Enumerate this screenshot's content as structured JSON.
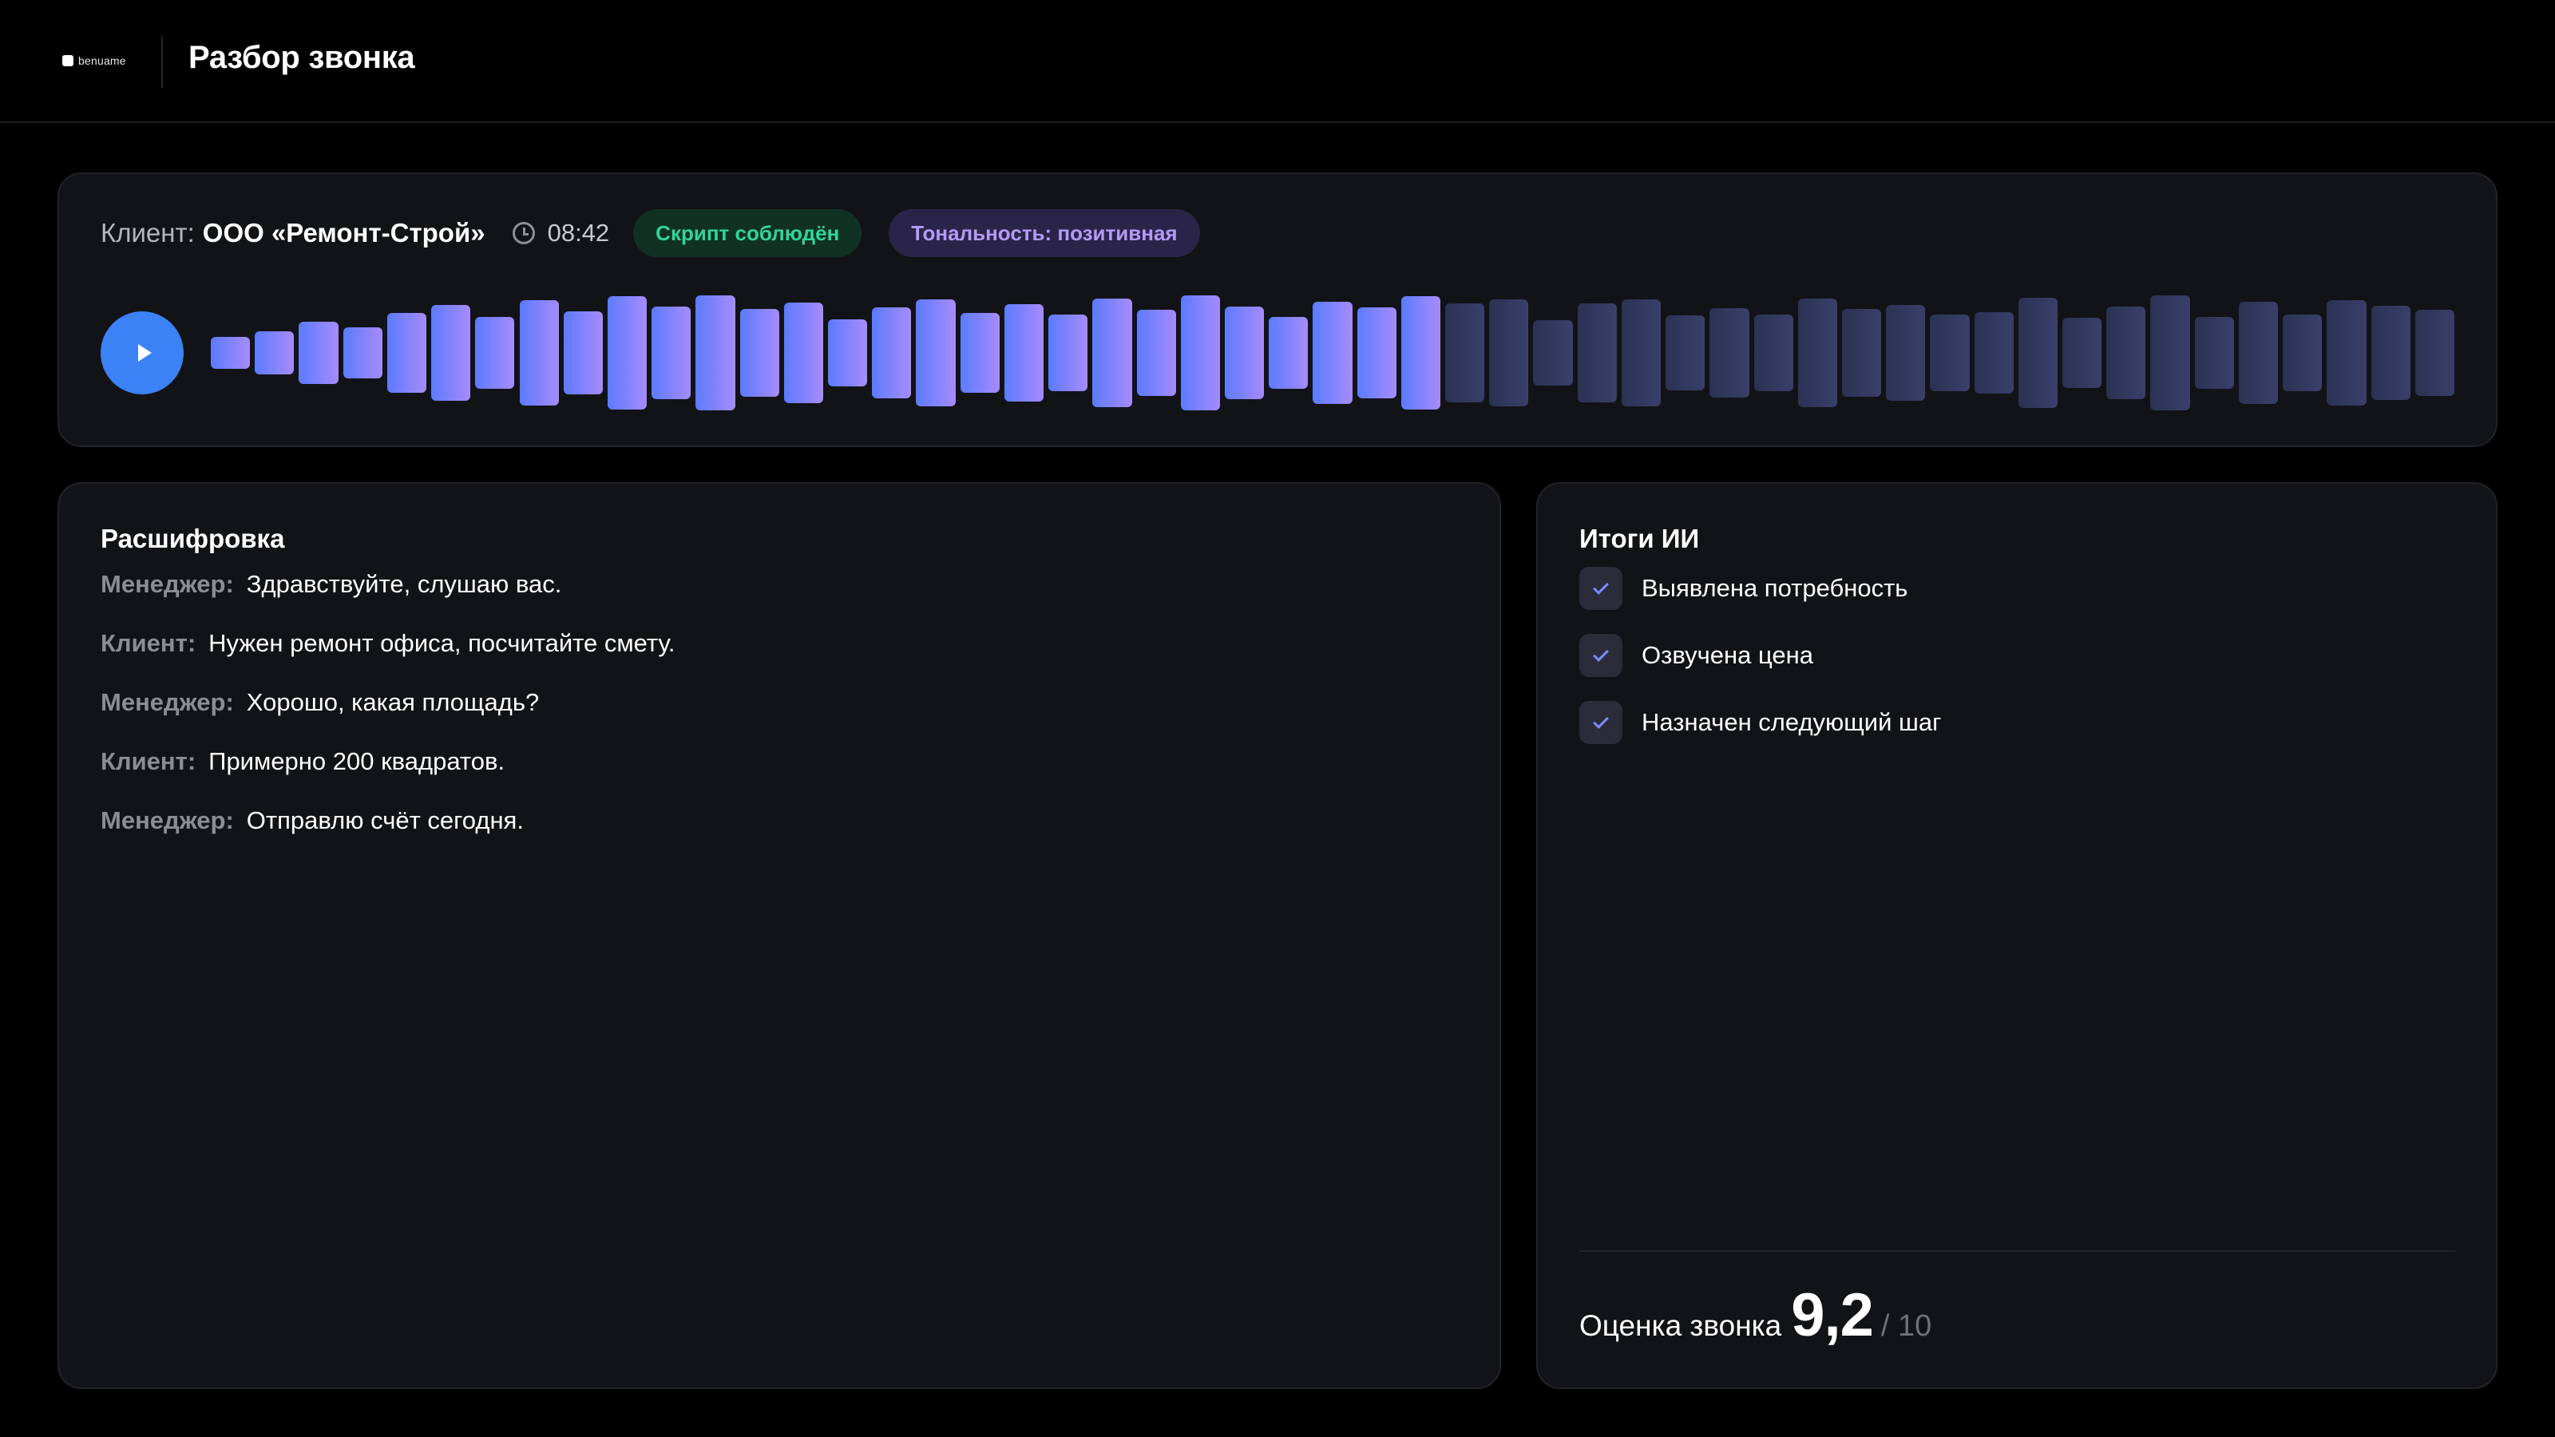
{
  "app": {
    "logo_text": "benuame",
    "title": "Разбор звонка"
  },
  "player": {
    "client_label": "Клиент:",
    "client_name": "ООО «Ремонт-Строй»",
    "duration": "08:42",
    "badges": {
      "script": "Скрипт соблюдён",
      "tone": "Тональность: позитивная"
    },
    "play_icon": "play-icon",
    "progress": 0.54,
    "waveform_levels": [
      0.28,
      0.38,
      0.54,
      0.44,
      0.7,
      0.83,
      0.63,
      0.92,
      0.72,
      0.98,
      0.81,
      1.0,
      0.76,
      0.88,
      0.58,
      0.79,
      0.93,
      0.7,
      0.85,
      0.66,
      0.94,
      0.75,
      1.0,
      0.81,
      0.62,
      0.89,
      0.79,
      0.98,
      0.86,
      0.93,
      0.57,
      0.86,
      0.93,
      0.65,
      0.78,
      0.66,
      0.94,
      0.77,
      0.83,
      0.66,
      0.71,
      0.96,
      0.61,
      0.8,
      1.0,
      0.63,
      0.89,
      0.67,
      0.92,
      0.82,
      0.75
    ],
    "colors": {
      "played_from": "#5b7bff",
      "played_to": "#a78bfa",
      "unplayed_from": "#2b3253",
      "unplayed_to": "#3a3f6b",
      "play_button": "#3b82f6"
    }
  },
  "transcript": {
    "title": "Расшифровка",
    "lines": [
      {
        "speaker": "Менеджер:",
        "text": "Здравствуйте, слушаю вас."
      },
      {
        "speaker": "Клиент:",
        "text": "Нужен ремонт офиса, посчитайте смету."
      },
      {
        "speaker": "Менеджер:",
        "text": "Хорошо, какая площадь?"
      },
      {
        "speaker": "Клиент:",
        "text": "Примерно 200 квадратов."
      },
      {
        "speaker": "Менеджер:",
        "text": "Отправлю счёт сегодня."
      }
    ]
  },
  "summary": {
    "title": "Итоги ИИ",
    "items": [
      {
        "label": "Выявлена потребность",
        "icon": "check-icon"
      },
      {
        "label": "Озвучена цена",
        "icon": "check-icon"
      },
      {
        "label": "Назначен следующий шаг",
        "icon": "check-icon"
      }
    ],
    "score_label": "Оценка звонка",
    "score_value": "9,2",
    "score_max": "/ 10"
  }
}
